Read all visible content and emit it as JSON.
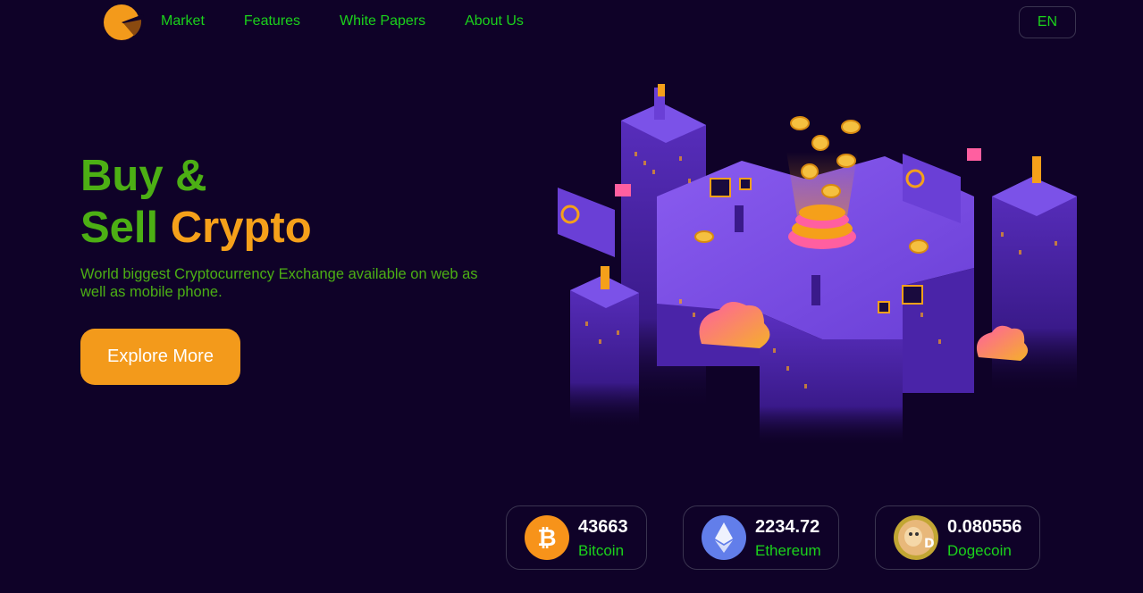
{
  "nav": {
    "links": [
      "Market",
      "Features",
      "White Papers",
      "About Us"
    ],
    "language": "EN"
  },
  "hero": {
    "title_line1": "Buy &",
    "title_line2_part1": "Sell",
    "title_line2_part2": "Crypto",
    "subtitle": "World biggest Cryptocurrency Exchange available on web as well as mobile phone.",
    "cta": "Explore More"
  },
  "coins": [
    {
      "price": "43663",
      "name": "Bitcoin",
      "icon": "bitcoin-icon",
      "color": "#f7931a"
    },
    {
      "price": "2234.72",
      "name": "Ethereum",
      "icon": "ethereum-icon",
      "color": "#627eea"
    },
    {
      "price": "0.080556",
      "name": "Dogecoin",
      "icon": "dogecoin-icon",
      "color": "#c2a633"
    }
  ],
  "colors": {
    "background": "#0f0228",
    "nav_text": "#1bd21b",
    "hero_green": "#4caf14",
    "accent_orange": "#f39a1b",
    "purple": "#6a3fd6"
  }
}
